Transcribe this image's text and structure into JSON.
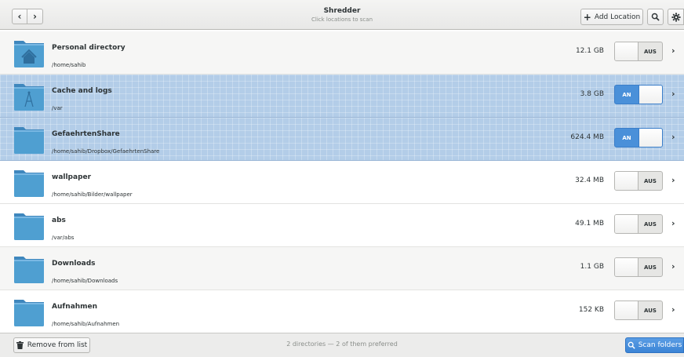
{
  "header": {
    "title": "Shredder",
    "subtitle": "Click locations to scan",
    "back_icon": "chevron-left-icon",
    "forward_icon": "chevron-right-icon",
    "add_location_label": "Add Location",
    "search_icon": "search-icon",
    "settings_icon": "gear-icon"
  },
  "locations": [
    {
      "name": "Personal directory",
      "path": "/home/sahib",
      "size": "12.1 GB",
      "state": "AUS",
      "on": false,
      "icon": "home-folder-icon"
    },
    {
      "name": "Cache and logs",
      "path": "/var",
      "size": "3.8 GB",
      "state": "AN",
      "on": true,
      "icon": "system-folder-icon"
    },
    {
      "name": "GefaehrtenShare",
      "path": "/home/sahib/Dropbox/GefaehrtenShare",
      "size": "624.4 MB",
      "state": "AN",
      "on": true,
      "icon": "folder-icon"
    },
    {
      "name": "wallpaper",
      "path": "/home/sahib/Bilder/wallpaper",
      "size": "32.4 MB",
      "state": "AUS",
      "on": false,
      "icon": "folder-icon"
    },
    {
      "name": "abs",
      "path": "/var/abs",
      "size": "49.1 MB",
      "state": "AUS",
      "on": false,
      "icon": "folder-icon"
    },
    {
      "name": "Downloads",
      "path": "/home/sahib/Downloads",
      "size": "1.1 GB",
      "state": "AUS",
      "on": false,
      "icon": "folder-icon"
    },
    {
      "name": "Aufnahmen",
      "path": "/home/sahib/Aufnahmen",
      "size": "152 KB",
      "state": "AUS",
      "on": false,
      "icon": "folder-icon"
    }
  ],
  "footer": {
    "remove_label": "Remove from list",
    "status": "2 directories — 2 of them preferred",
    "scan_label": "Scan folders"
  },
  "colors": {
    "accent": "#4a90d9",
    "selection": "#b3cde8",
    "folder": "#4f9fd1"
  }
}
